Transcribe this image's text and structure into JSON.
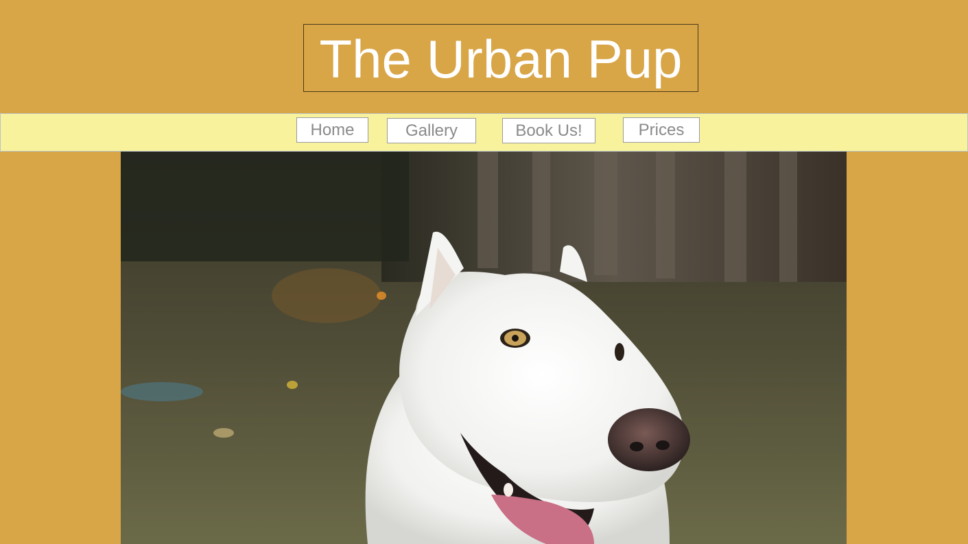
{
  "header": {
    "title": "The Urban Pup"
  },
  "nav": {
    "items": [
      {
        "label": "Home"
      },
      {
        "label": "Gallery"
      },
      {
        "label": "Book Us!"
      },
      {
        "label": "Prices"
      }
    ]
  },
  "hero": {
    "icon": "white-dog-photo"
  },
  "colors": {
    "page_background": "#d8a547",
    "nav_background": "#f8f29d",
    "title_text": "#ffffff",
    "nav_text": "#8a8a8a"
  }
}
